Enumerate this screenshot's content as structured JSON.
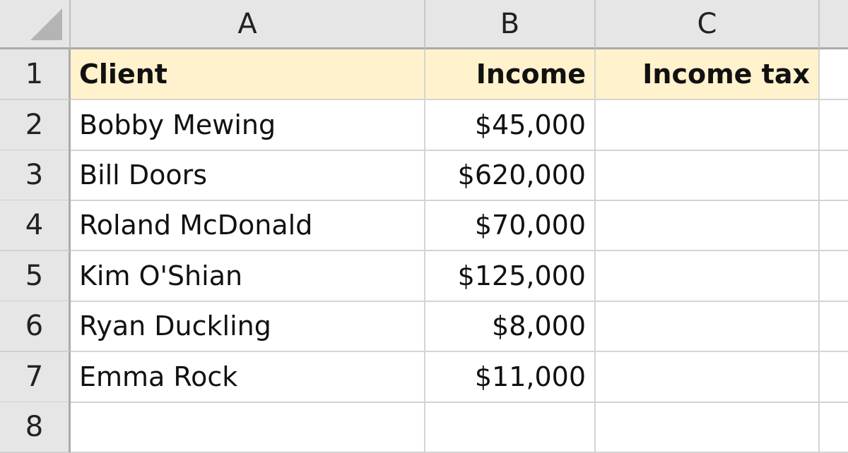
{
  "sheet": {
    "columns": [
      "A",
      "B",
      "C"
    ],
    "row_numbers": [
      "1",
      "2",
      "3",
      "4",
      "5",
      "6",
      "7",
      "8"
    ],
    "header_fill": "#FFF2CC",
    "header": [
      "Client",
      "Income",
      "Income tax"
    ],
    "rows": [
      [
        "Bobby Mewing",
        "$45,000",
        ""
      ],
      [
        "Bill Doors",
        "$620,000",
        ""
      ],
      [
        "Roland McDonald",
        "$70,000",
        ""
      ],
      [
        "Kim O'Shian",
        "$125,000",
        ""
      ],
      [
        "Ryan Duckling",
        "$8,000",
        ""
      ],
      [
        "Emma Rock",
        "$11,000",
        ""
      ],
      [
        "",
        "",
        ""
      ]
    ]
  }
}
